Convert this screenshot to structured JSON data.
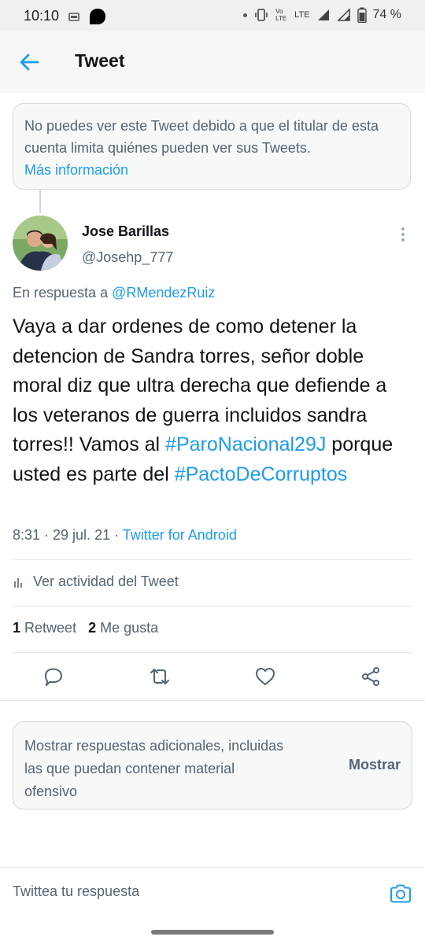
{
  "status_bar": {
    "time": "10:10",
    "battery_percent": "74 %",
    "lte": "LTE",
    "vo_lte": "Vo LTE"
  },
  "app_bar": {
    "title": "Tweet",
    "back_icon": "arrow-left-icon"
  },
  "notice": {
    "text": "No puedes ver este Tweet debido a que el titular de esta cuenta limita quiénes pueden ver sus Tweets.",
    "link": "Más información"
  },
  "tweet": {
    "author_name": "Jose Barillas",
    "author_handle": "@Josehp_777",
    "reply_prefix": "En respuesta a",
    "reply_to": "@RMendezRuiz",
    "text_before": "Vaya a dar ordenes de como detener la detencion de Sandra torres, señor doble moral diz que ultra derecha que defiende a los veteranos de guerra incluidos sandra torres!! Vamos al ",
    "hashtag_1": "#ParoNacional29J",
    "text_middle": " porque usted es parte del ",
    "hashtag_2": "#PactoDeCorruptos",
    "time": "8:31 · 29 jul. 21 · ",
    "source": "Twitter for Android"
  },
  "activity": {
    "label": "Ver actividad del Tweet"
  },
  "stats": {
    "retweets_count": "1",
    "retweets_label": "Retweet",
    "likes_count": "2",
    "likes_label": "Me gusta"
  },
  "more_replies": {
    "text": "Mostrar respuestas adicionales, incluidas las que puedan contener material ofensivo",
    "button": "Mostrar"
  },
  "compose": {
    "placeholder": "Twittea tu respuesta"
  },
  "colors": {
    "accent": "#1d9bf0",
    "secondary_text": "#536471",
    "primary_text": "#0f1419"
  }
}
